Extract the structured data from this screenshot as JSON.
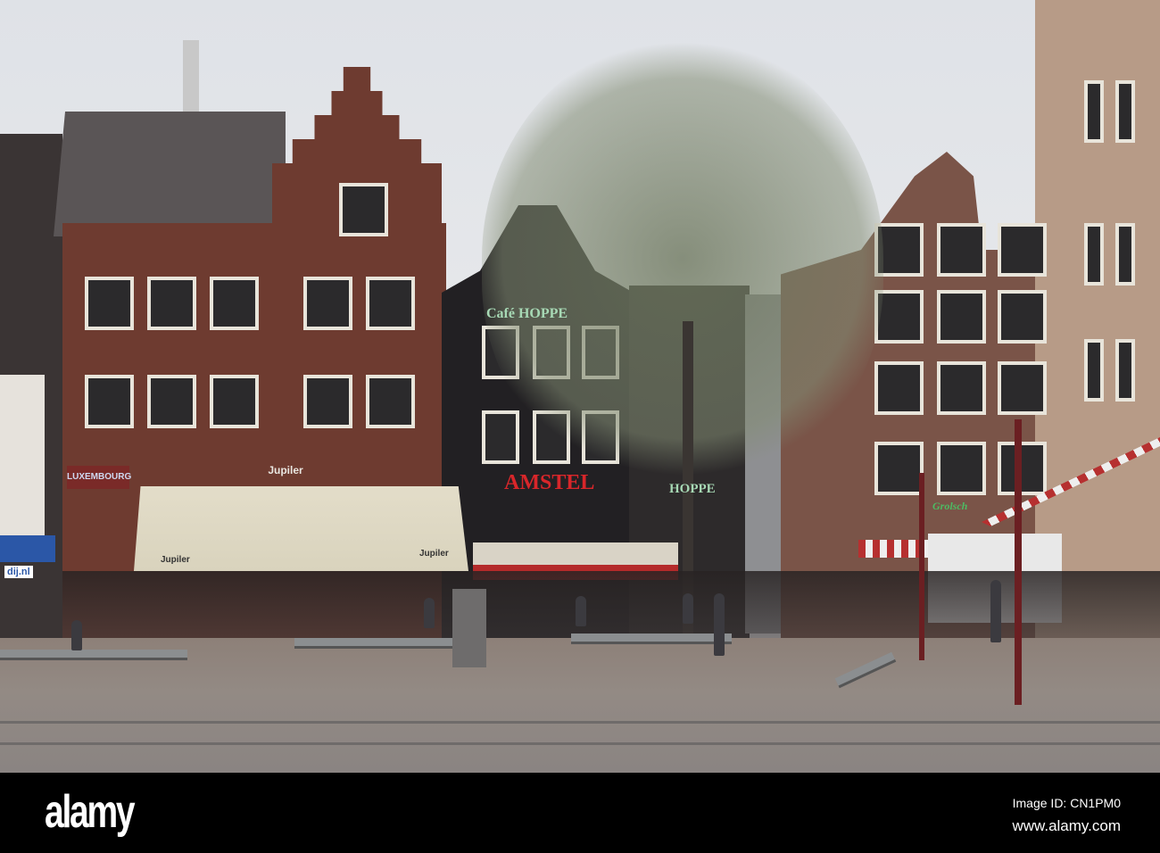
{
  "signs": {
    "luxembourg": "LUXEMBOURG",
    "jupiler_top": "Jupiler",
    "jupiler_awning_left": "Jupiler",
    "jupiler_awning_right": "Jupiler",
    "cafe_hoppe": "Café HOPPE",
    "amstel": "AMSTEL",
    "hoppe_lower": "HOPPE",
    "grolsch": "Grolsch",
    "dij": "dij.nl"
  },
  "watermark": {
    "logo": "alamy",
    "image_id": "Image ID: CN1PM0",
    "website": "www.alamy.com"
  },
  "colors": {
    "sky": "#e2e4e8",
    "brick": "#6e3b30",
    "black_facade": "#222023",
    "ground": "#8d8078"
  }
}
